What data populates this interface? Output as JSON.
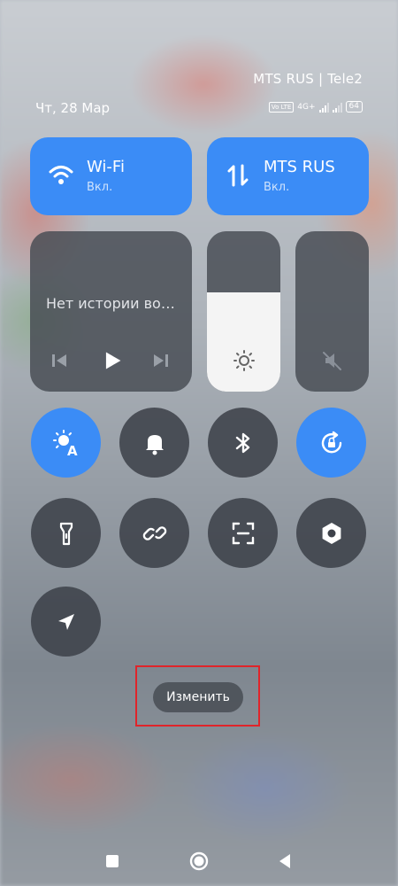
{
  "status": {
    "operators": "MTS RUS | Tele2",
    "date": "Чт, 28 Мар",
    "volte": "Vo LTE",
    "network": "4G+",
    "battery": "64"
  },
  "tiles": {
    "wifi": {
      "title": "Wi-Fi",
      "state": "Вкл."
    },
    "mobile": {
      "title": "MTS RUS",
      "state": "Вкл."
    }
  },
  "media": {
    "text": "Нет истории во…"
  },
  "brightness": {
    "level": 0.62
  },
  "volume": {
    "level": 0.0,
    "muted": true
  },
  "toggles": [
    {
      "name": "auto-brightness",
      "icon": "auto-brightness-icon",
      "on": true
    },
    {
      "name": "sound",
      "icon": "bell-icon",
      "on": false
    },
    {
      "name": "bluetooth",
      "icon": "bluetooth-icon",
      "on": false
    },
    {
      "name": "rotation-lock",
      "icon": "rotation-lock-icon",
      "on": true
    },
    {
      "name": "flashlight",
      "icon": "flashlight-icon",
      "on": false
    },
    {
      "name": "link",
      "icon": "link-icon",
      "on": false
    },
    {
      "name": "scanner",
      "icon": "scan-icon",
      "on": false
    },
    {
      "name": "settings",
      "icon": "hex-nut-icon",
      "on": false
    },
    {
      "name": "location",
      "icon": "location-arrow-icon",
      "on": false
    }
  ],
  "edit_button": {
    "label": "Изменить"
  },
  "colors": {
    "accent": "#3b8cf6",
    "tile_dark": "#464a52",
    "highlight": "#e0242a"
  }
}
